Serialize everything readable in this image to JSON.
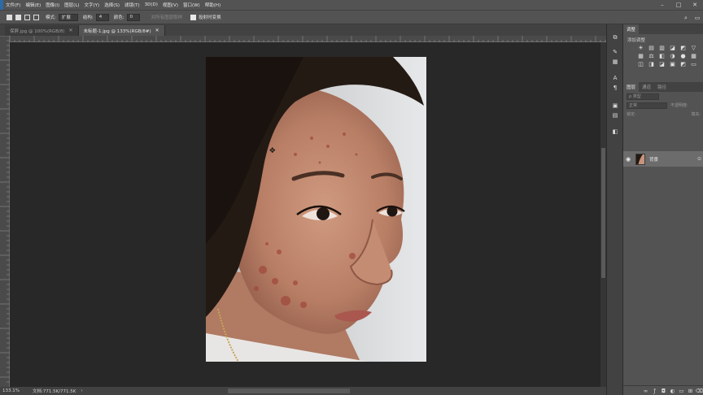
{
  "menu": {
    "items": [
      "文件(F)",
      "编辑(E)",
      "图像(I)",
      "图层(L)",
      "文字(Y)",
      "选择(S)",
      "滤镜(T)",
      "3D(D)",
      "视图(V)",
      "窗口(W)",
      "帮助(H)"
    ],
    "win_minimize": "–",
    "win_maximize": "□",
    "win_close": "✕"
  },
  "options": {
    "mode_label": "模式:",
    "mode_value": "扩展",
    "structure_label": "结构:",
    "structure_value": "4",
    "color_label": "颜色:",
    "color_value": "0",
    "sample_all_label": "对所有图层取样",
    "transform_label": "投射时变换"
  },
  "tabs": [
    {
      "label": "保屏.jpg @ 100%(RGB/8)",
      "close": "✕",
      "active": false
    },
    {
      "label": "未标题-1.jpg @ 133%(RGB/8#)",
      "close": "✕",
      "active": true
    }
  ],
  "status": {
    "zoom": "133.1%",
    "doc": "文档:771.5K/771.5K",
    "arrow": "›"
  },
  "panel": {
    "tabs_top": [
      "调整"
    ],
    "adjust_title": "添加调整",
    "adjust_icons": [
      "☀",
      "▤",
      "▥",
      "◪",
      "◩",
      "▽",
      "▦",
      "⚖",
      "◧",
      "◑",
      "●",
      "▦",
      "◫",
      "◨",
      "◪",
      "▣",
      "◩",
      "▭"
    ],
    "tabs_layers": [
      "图层",
      "通道",
      "路径"
    ],
    "kind_label": "ρ 类型",
    "blend_mode": "正常",
    "opacity_label": "不透明度:",
    "lock_label": "锁定:",
    "fill_label": "填充:",
    "layer_name": "背景",
    "layer_eye": "👁",
    "layer_lock": "🔒"
  },
  "colors": {
    "ui_dark": "#282828",
    "ui_mid": "#535353",
    "ui_tab": "#424242",
    "selected_layer": "#6c6c6c"
  }
}
